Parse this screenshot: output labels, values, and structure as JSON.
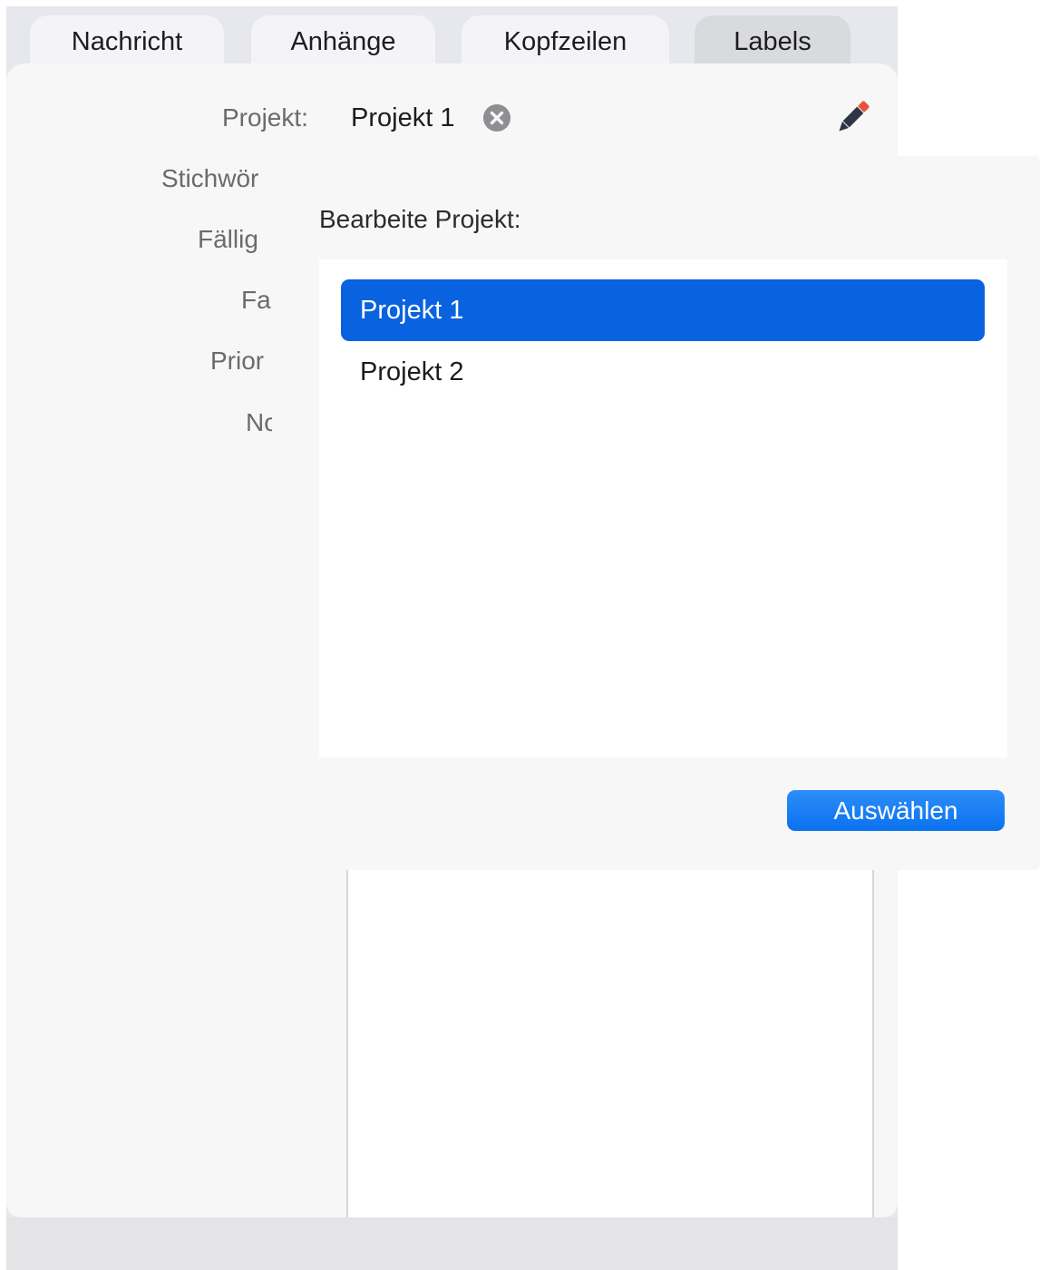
{
  "tabs": [
    {
      "label": "Nachricht",
      "active": false
    },
    {
      "label": "Anhänge",
      "active": false
    },
    {
      "label": "Kopfzeilen",
      "active": false
    },
    {
      "label": "Labels",
      "active": true
    }
  ],
  "fields": {
    "project_label": "Projekt:",
    "project_value": "Projekt 1",
    "keywords_label": "Stichwör",
    "due_label": "Fällig",
    "color_label": "Fa",
    "priority_label": "Prior",
    "notes_label": "No"
  },
  "popover": {
    "title": "Bearbeite Projekt:",
    "items": [
      {
        "label": "Projekt 1",
        "selected": true
      },
      {
        "label": "Projekt 2",
        "selected": false
      }
    ],
    "button_label": "Auswählen"
  },
  "colors": {
    "accent": "#0962e0",
    "button": "#0a72f0",
    "pencil_tip": "#e5533d",
    "pencil_body": "#2f3447"
  },
  "icons": {
    "clear": "clear-circle-icon",
    "edit": "pencil-icon"
  }
}
